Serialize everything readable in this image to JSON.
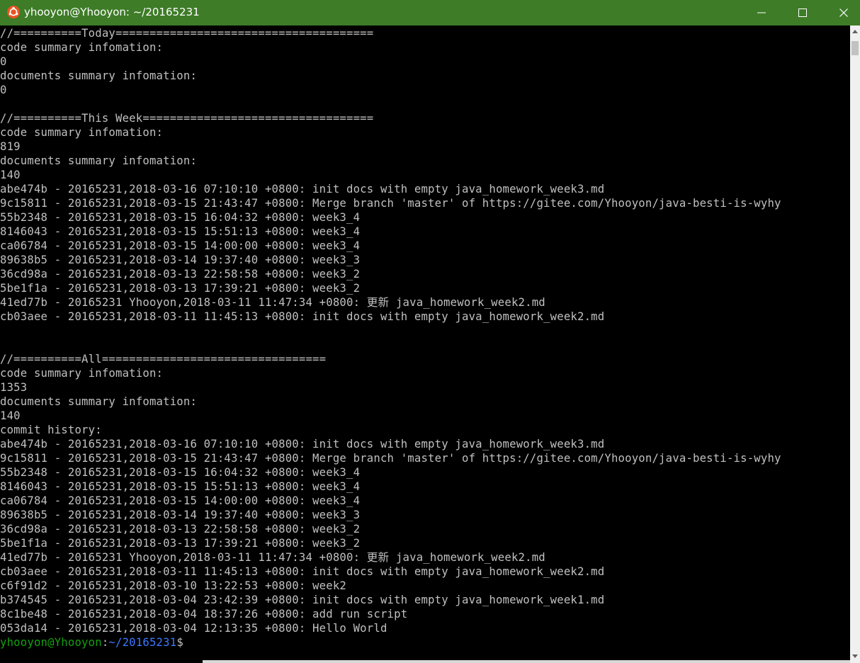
{
  "window": {
    "title": "yhooyon@Yhooyon: ~/20165231",
    "app_icon": "ubuntu-icon",
    "titlebar_color": "#3e7c28",
    "controls": [
      "minimize-icon",
      "maximize-icon",
      "close-icon"
    ]
  },
  "terminal": {
    "background": "#000000",
    "foreground": "#c0c0c0",
    "lines": [
      "//==========Today======================================",
      "code summary infomation:",
      "0",
      "documents summary infomation:",
      "0",
      "",
      "//==========This Week==================================",
      "code summary infomation:",
      "819",
      "documents summary infomation:",
      "140",
      "abe474b - 20165231,2018-03-16 07:10:10 +0800: init docs with empty java_homework_week3.md",
      "9c15811 - 20165231,2018-03-15 21:43:47 +0800: Merge branch 'master' of https://gitee.com/Yhooyon/java-besti-is-wyhy",
      "55b2348 - 20165231,2018-03-15 16:04:32 +0800: week3_4",
      "8146043 - 20165231,2018-03-15 15:51:13 +0800: week3_4",
      "ca06784 - 20165231,2018-03-15 14:00:00 +0800: week3_4",
      "89638b5 - 20165231,2018-03-14 19:37:40 +0800: week3_3",
      "36cd98a - 20165231,2018-03-13 22:58:58 +0800: week3_2",
      "5be1f1a - 20165231,2018-03-13 17:39:21 +0800: week3_2",
      "41ed77b - 20165231 Yhooyon,2018-03-11 11:47:34 +0800: 更新 java_homework_week2.md",
      "cb03aee - 20165231,2018-03-11 11:45:13 +0800: init docs with empty java_homework_week2.md",
      "",
      "",
      "//==========All=================================",
      "code summary infomation:",
      "1353",
      "documents summary infomation:",
      "140",
      "commit history:",
      "abe474b - 20165231,2018-03-16 07:10:10 +0800: init docs with empty java_homework_week3.md",
      "9c15811 - 20165231,2018-03-15 21:43:47 +0800: Merge branch 'master' of https://gitee.com/Yhooyon/java-besti-is-wyhy",
      "55b2348 - 20165231,2018-03-15 16:04:32 +0800: week3_4",
      "8146043 - 20165231,2018-03-15 15:51:13 +0800: week3_4",
      "ca06784 - 20165231,2018-03-15 14:00:00 +0800: week3_4",
      "89638b5 - 20165231,2018-03-14 19:37:40 +0800: week3_3",
      "36cd98a - 20165231,2018-03-13 22:58:58 +0800: week3_2",
      "5be1f1a - 20165231,2018-03-13 17:39:21 +0800: week3_2",
      "41ed77b - 20165231 Yhooyon,2018-03-11 11:47:34 +0800: 更新 java_homework_week2.md",
      "cb03aee - 20165231,2018-03-11 11:45:13 +0800: init docs with empty java_homework_week2.md",
      "c6f91d2 - 20165231,2018-03-10 13:22:53 +0800: week2",
      "b374545 - 20165231,2018-03-04 23:42:39 +0800: init docs with empty java_homework_week1.md",
      "8c1be48 - 20165231,2018-03-04 18:37:26 +0800: add run script",
      "053da14 - 20165231,2018-03-04 12:13:35 +0800: Hello World"
    ],
    "prompt": {
      "user_host": "yhooyon@Yhooyon",
      "separator": ":",
      "path": "~/20165231",
      "symbol": "$",
      "user_color": "#13a10e",
      "path_color": "#3b78ff"
    }
  }
}
